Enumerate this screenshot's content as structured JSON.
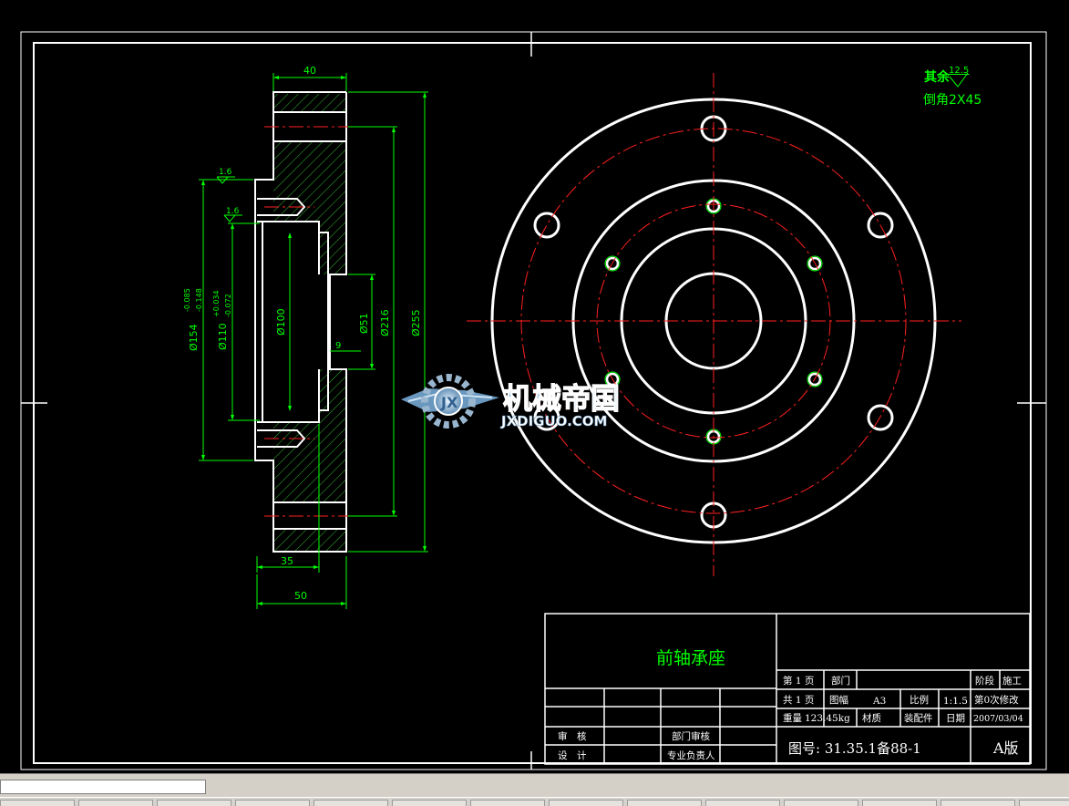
{
  "part_name": "前轴承座",
  "watermark": {
    "cn": "机械帝国",
    "url": "JXDIGUO.COM"
  },
  "notes": {
    "roughness": "其余",
    "roughness_value": "12.5",
    "chamfer": "倒角2X45"
  },
  "dims": {
    "d40": "40",
    "d35": "35",
    "d50": "50",
    "d9": "9",
    "r16a": "1.6",
    "r16b": "1.6",
    "phi154": "Ø154",
    "phi154_tol_u": "-0.085",
    "phi154_tol_l": "-0.148",
    "phi110": "Ø110",
    "phi110_tol_u": "+0.034",
    "phi110_tol_l": "-0.072",
    "phi100": "Ø100",
    "phi51": "Ø51",
    "phi216": "Ø216",
    "phi255": "Ø255"
  },
  "title_block": {
    "sheet": "第 1 页",
    "dept": "部门",
    "stage": "阶段",
    "stage_value": "施工",
    "total": "共 1 页",
    "size_label": "图幅",
    "size": "A3",
    "scale_label": "比例",
    "scale": "1:1.5",
    "revision": "第0次修改",
    "weight_label": "重量",
    "weight": "123.45kg",
    "material_label": "材质",
    "material": "装配件",
    "date_label": "日期",
    "date": "2007/03/04",
    "review": "审　核",
    "design": "设　计",
    "dept_review": "部门审核",
    "chief": "专业负责人",
    "drawing_no": "图号: 31.35.1备88-1",
    "version": "A版"
  },
  "colors": {
    "outline": "#ffffff",
    "dimension": "#00ff00",
    "center": "#ff0000",
    "hatch": "#00ff00",
    "text": "#00ff00"
  },
  "taskbar": {
    "tasks": [
      "task-1",
      "task-2",
      "task-3",
      "task-4",
      "task-5",
      "task-6",
      "task-7",
      "task-8",
      "task-9",
      "task-10",
      "task-11",
      "task-12",
      "task-13",
      "task-14"
    ]
  }
}
